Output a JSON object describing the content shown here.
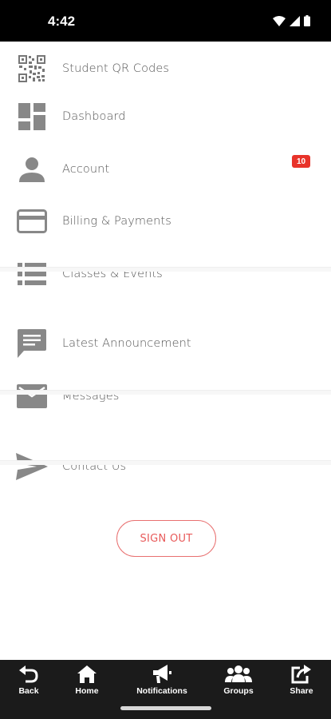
{
  "status_bar": {
    "time": "4:42"
  },
  "menu": {
    "items": [
      {
        "label": "Student QR Codes",
        "icon": "qr-code-icon"
      },
      {
        "label": "Dashboard",
        "icon": "dashboard-icon"
      },
      {
        "label": "Account",
        "icon": "person-icon",
        "badge": "10"
      },
      {
        "label": "Billing & Payments",
        "icon": "credit-card-icon"
      },
      {
        "label": "Classes & Events",
        "icon": "list-icon"
      },
      {
        "label": "Latest Announcement",
        "icon": "announcement-icon"
      },
      {
        "label": "Messages",
        "icon": "envelope-icon"
      },
      {
        "label": "Contact Us",
        "icon": "send-icon"
      }
    ]
  },
  "sign_out_label": "SIGN OUT",
  "bottom_nav": {
    "items": [
      {
        "label": "Back",
        "icon": "back-arrow-icon"
      },
      {
        "label": "Home",
        "icon": "home-icon"
      },
      {
        "label": "Notifications",
        "icon": "megaphone-icon"
      },
      {
        "label": "Groups",
        "icon": "groups-icon"
      },
      {
        "label": "Share",
        "icon": "share-icon"
      }
    ]
  },
  "colors": {
    "accent": "#e8332a",
    "icon_gray": "#8a8a8a",
    "nav_bg": "#1b1b1b"
  }
}
